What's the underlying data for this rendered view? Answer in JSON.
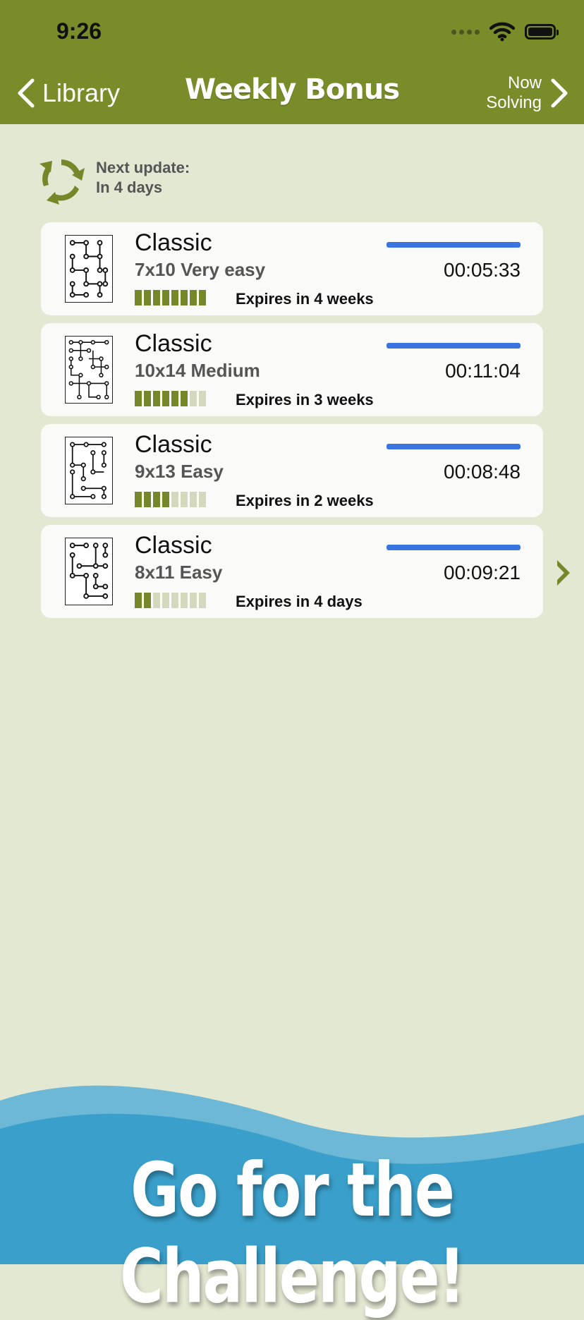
{
  "status": {
    "time": "9:26"
  },
  "nav": {
    "back_label": "Library",
    "title": "Weekly Bonus",
    "now_solving": [
      "Now",
      "Solving"
    ]
  },
  "next_update": {
    "line1": "Next update:",
    "line2": "In 4 days"
  },
  "puzzles": [
    {
      "title": "Classic",
      "subtitle": "7x10 Very easy",
      "time": "00:05:33",
      "expires": "Expires in 4 weeks",
      "weeks_left_bars": 8,
      "total_bars": 8
    },
    {
      "title": "Classic",
      "subtitle": "10x14 Medium",
      "time": "00:11:04",
      "expires": "Expires in 3 weeks",
      "weeks_left_bars": 6,
      "total_bars": 8
    },
    {
      "title": "Classic",
      "subtitle": "9x13 Easy",
      "time": "00:08:48",
      "expires": "Expires in 2 weeks",
      "weeks_left_bars": 4,
      "total_bars": 8
    },
    {
      "title": "Classic",
      "subtitle": "8x11 Easy",
      "time": "00:09:21",
      "expires": "Expires in 4 days",
      "weeks_left_bars": 2,
      "total_bars": 8
    }
  ],
  "banner": {
    "text": "Go for the Challenge!"
  },
  "colors": {
    "header": "#788c2a",
    "background": "#e3e8d2",
    "bar_on": "#74882a",
    "bar_off": "#d4d9be",
    "progress": "#3a74e0",
    "wave_light": "#6cb8d6",
    "wave_dark": "#3aa0cb"
  }
}
